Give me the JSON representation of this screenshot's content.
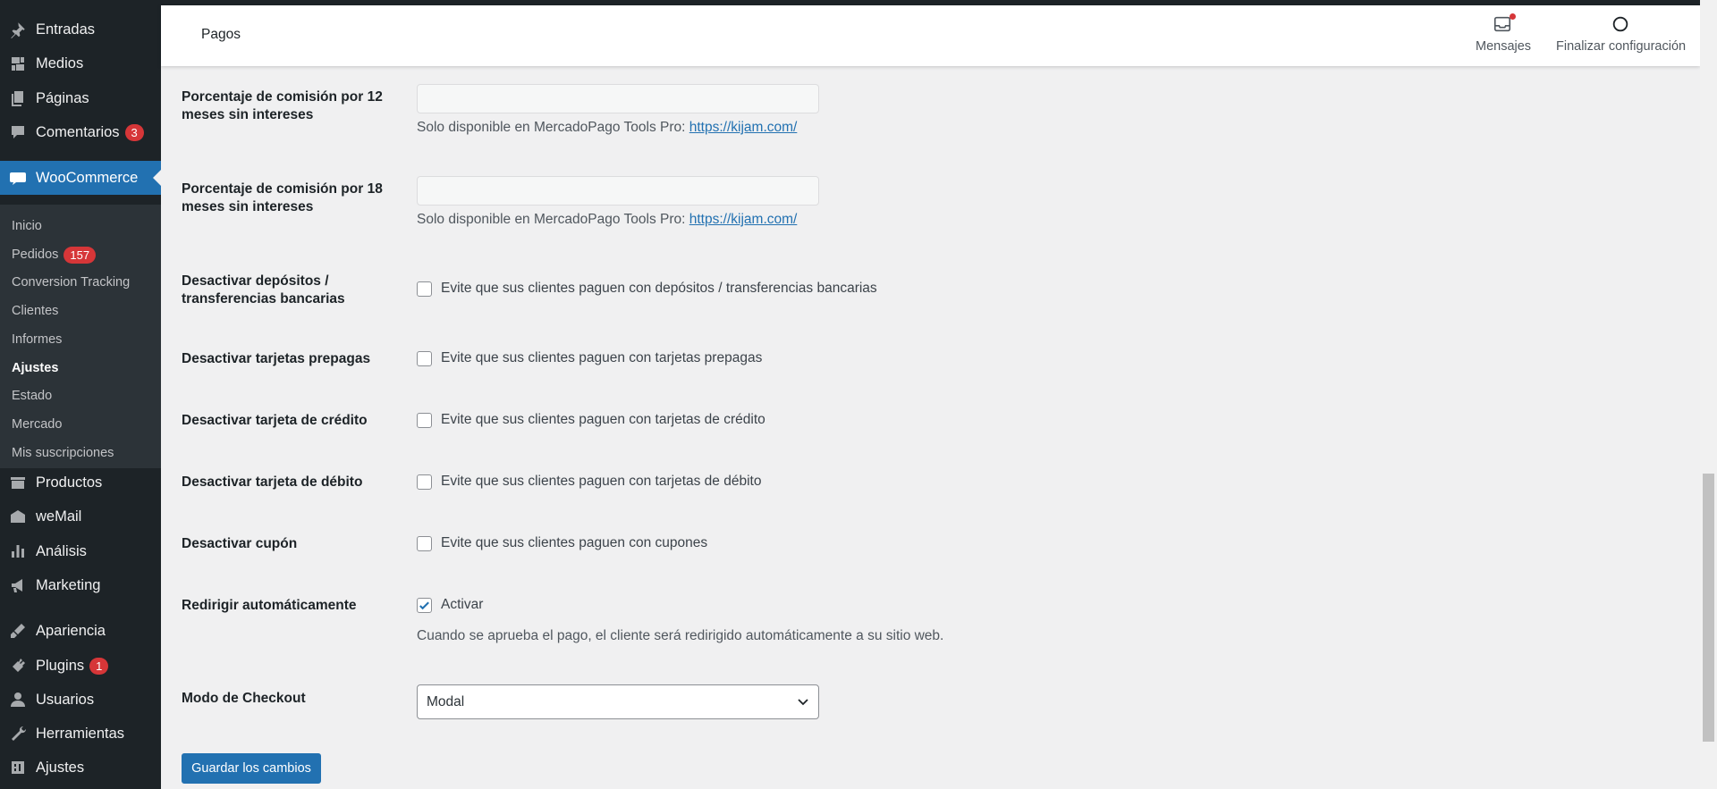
{
  "sidebar": {
    "items": [
      {
        "label": "Entradas",
        "icon": "pin-icon"
      },
      {
        "label": "Medios",
        "icon": "media-icon"
      },
      {
        "label": "Páginas",
        "icon": "pages-icon"
      },
      {
        "label": "Comentarios",
        "icon": "comments-icon",
        "badge": "3"
      },
      {
        "label": "WooCommerce",
        "icon": "woo-icon"
      },
      {
        "label": "Productos",
        "icon": "products-icon"
      },
      {
        "label": "weMail",
        "icon": "wemail-icon"
      },
      {
        "label": "Análisis",
        "icon": "analytics-icon"
      },
      {
        "label": "Marketing",
        "icon": "marketing-icon"
      },
      {
        "label": "Apariencia",
        "icon": "appearance-icon"
      },
      {
        "label": "Plugins",
        "icon": "plugins-icon",
        "badge": "1"
      },
      {
        "label": "Usuarios",
        "icon": "users-icon"
      },
      {
        "label": "Herramientas",
        "icon": "tools-icon"
      },
      {
        "label": "Ajustes",
        "icon": "settings-icon"
      }
    ],
    "submenu": [
      {
        "label": "Inicio"
      },
      {
        "label": "Pedidos",
        "badge": "157"
      },
      {
        "label": "Conversion Tracking"
      },
      {
        "label": "Clientes"
      },
      {
        "label": "Informes"
      },
      {
        "label": "Ajustes"
      },
      {
        "label": "Estado"
      },
      {
        "label": "Mercado"
      },
      {
        "label": "Mis suscripciones"
      }
    ]
  },
  "header": {
    "title": "Pagos",
    "messages_label": "Mensajes",
    "finish_label": "Finalizar configuración"
  },
  "form": {
    "commission_12_label": "Porcentaje de comisión por 12 meses sin intereses",
    "commission_12_desc": "Solo disponible en MercadoPago Tools Pro: ",
    "commission_12_link": "https://kijam.com/",
    "commission_18_label": "Porcentaje de comisión por 18 meses sin intereses",
    "commission_18_desc": "Solo disponible en MercadoPago Tools Pro: ",
    "commission_18_link": "https://kijam.com/",
    "deposits_label": "Desactivar depósitos / transferencias bancarias",
    "deposits_cb": "Evite que sus clientes paguen con depósitos / transferencias bancarias",
    "prepaid_label": "Desactivar tarjetas prepagas",
    "prepaid_cb": "Evite que sus clientes paguen con tarjetas prepagas",
    "credit_label": "Desactivar tarjeta de crédito",
    "credit_cb": "Evite que sus clientes paguen con tarjetas de crédito",
    "debit_label": "Desactivar tarjeta de débito",
    "debit_cb": "Evite que sus clientes paguen con tarjetas de débito",
    "coupon_label": "Desactivar cupón",
    "coupon_cb": "Evite que sus clientes paguen con cupones",
    "redirect_label": "Redirigir automáticamente",
    "redirect_cb": "Activar",
    "redirect_checked": true,
    "redirect_desc": "Cuando se aprueba el pago, el cliente será redirigido automáticamente a su sitio web.",
    "checkout_label": "Modo de Checkout",
    "checkout_value": "Modal",
    "save_label": "Guardar los cambios"
  },
  "colors": {
    "accent": "#2271b1",
    "sidebar_bg": "#1d2327",
    "badge": "#d63638"
  }
}
